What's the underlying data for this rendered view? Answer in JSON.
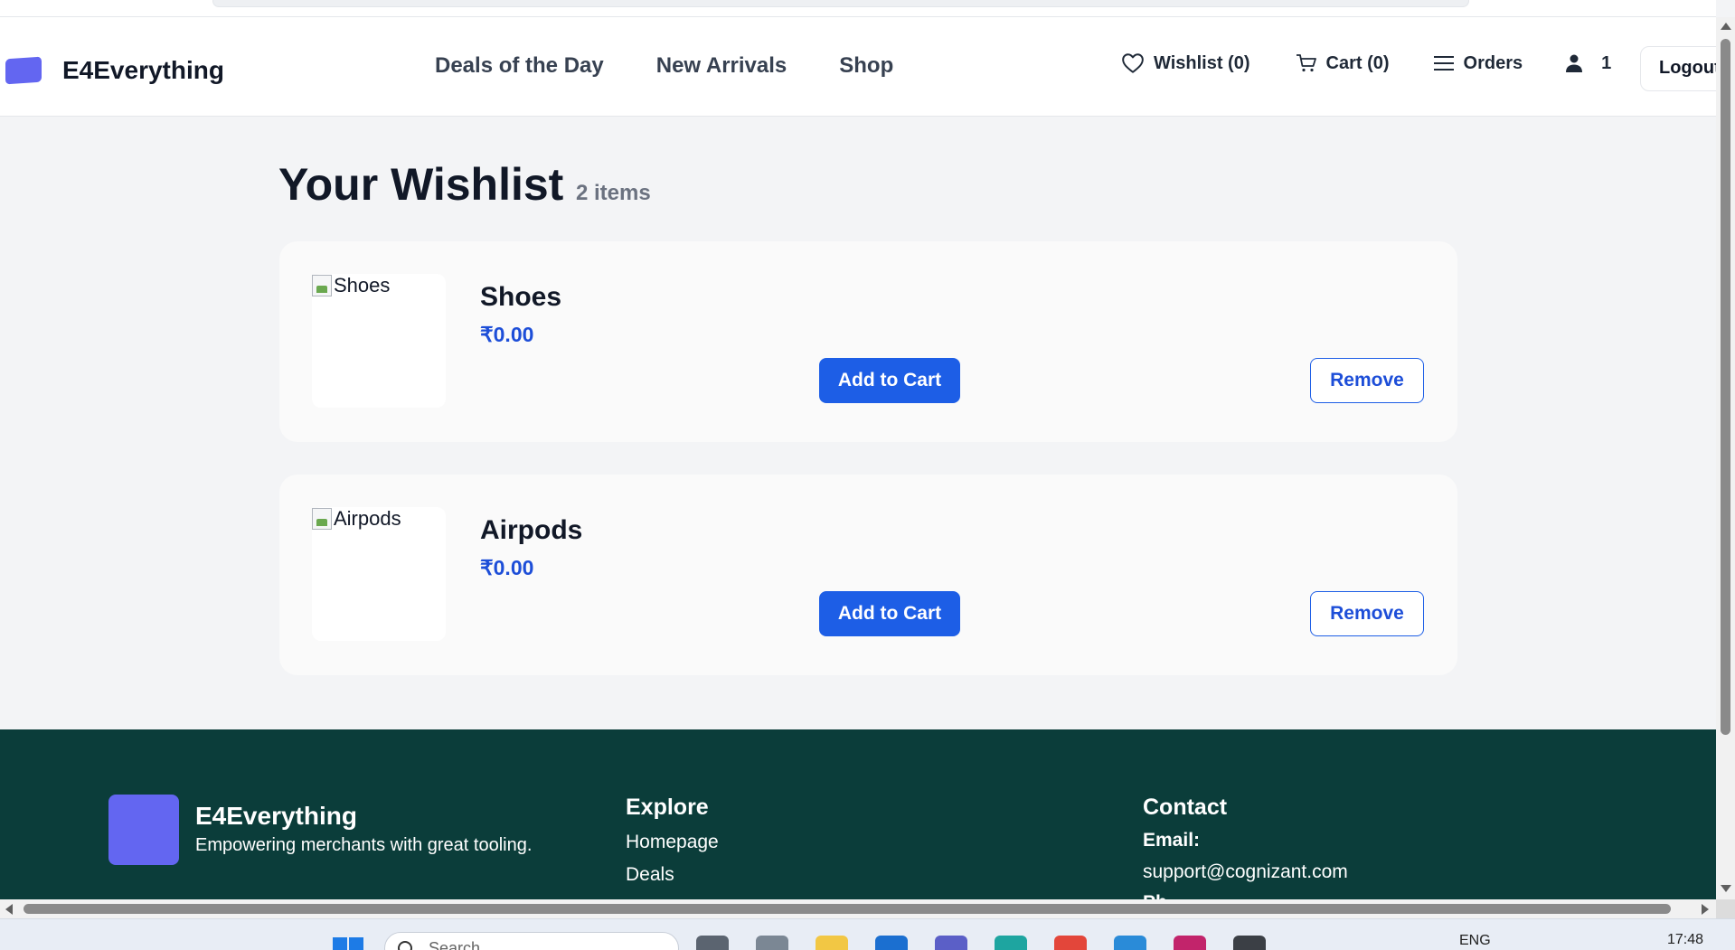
{
  "header": {
    "brand": "E4Everything",
    "nav": [
      "Deals of the Day",
      "New Arrivals",
      "Shop"
    ],
    "wishlist": "Wishlist (0)",
    "cart": "Cart (0)",
    "orders": "Orders",
    "user": "1",
    "logout": "Logout"
  },
  "page": {
    "title": "Your Wishlist",
    "count": "2 items"
  },
  "items": [
    {
      "name": "Shoes",
      "alt": "Shoes",
      "price": "₹0.00",
      "add": "Add to Cart",
      "remove": "Remove"
    },
    {
      "name": "Airpods",
      "alt": "Airpods",
      "price": "₹0.00",
      "add": "Add to Cart",
      "remove": "Remove"
    }
  ],
  "footer": {
    "brand": "E4Everything",
    "tagline": "Empowering merchants with great tooling.",
    "explore_heading": "Explore",
    "links": [
      "Homepage",
      "Deals"
    ],
    "contact_heading": "Contact",
    "email_label": "Email:",
    "email": "support@cognizant.com",
    "phone_label": "Ph"
  },
  "taskbar": {
    "search_placeholder": "Search",
    "language": "ENG",
    "time": "17:48"
  },
  "colors": {
    "accent": "#1d5ee6",
    "brand": "#6366f1",
    "footer_bg": "#0b3d3a",
    "price": "#1d4ed8"
  },
  "icons": [
    "heart-icon",
    "cart-icon",
    "menu-icon",
    "user-icon",
    "search-icon",
    "windows-icon"
  ]
}
